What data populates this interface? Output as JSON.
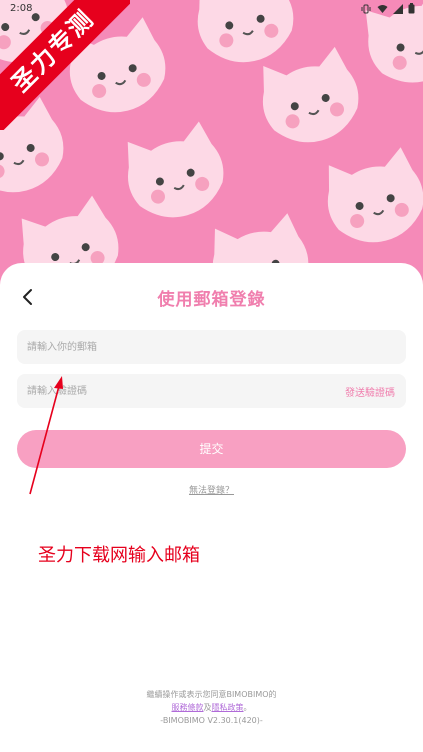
{
  "status_bar": {
    "time": "2:08"
  },
  "ribbon": {
    "text": "圣力专测"
  },
  "login": {
    "title": "使用郵箱登錄",
    "email_placeholder": "請輸入你的郵箱",
    "code_placeholder": "請輸入驗證碼",
    "send_code": "發送驗證碼",
    "submit": "提交",
    "cannot_login": "無法登錄？"
  },
  "annotation": {
    "text": "圣力下载网输入邮箱"
  },
  "footer": {
    "line1": "繼續操作或表示您同意BIMOBIMO的",
    "terms": "服務條款",
    "and": "及",
    "privacy": "隱私政策",
    "dot": "。",
    "version": "-BIMOBIMO V2.30.1(420)-"
  },
  "colors": {
    "accent": "#f07fae",
    "bg_pink": "#f58ab8",
    "ribbon": "#e6001d",
    "link": "#b06bd8"
  }
}
